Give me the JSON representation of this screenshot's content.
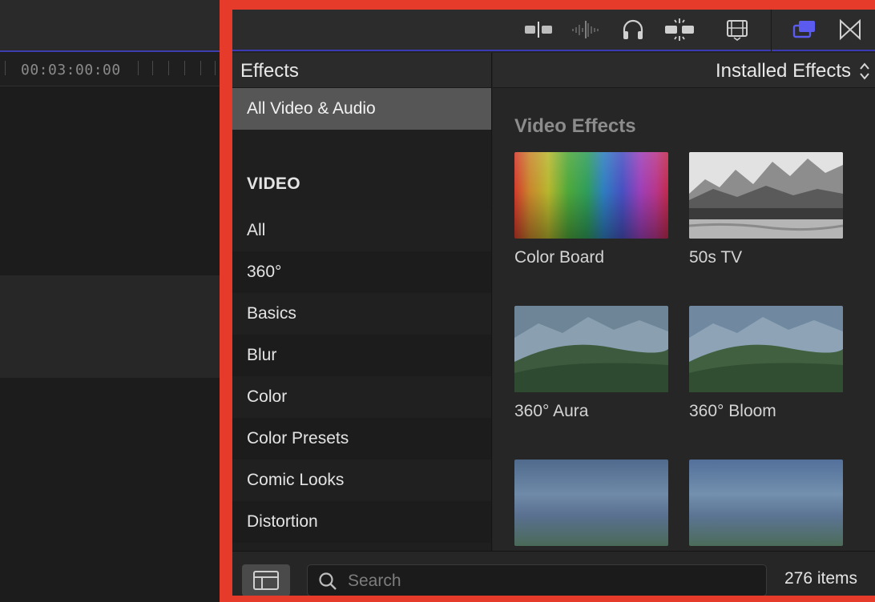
{
  "timeline": {
    "timecode": "00:03:00:00"
  },
  "toolbar": {
    "icons": [
      "clip-skimming-icon",
      "audio-skimming-icon",
      "headphones-icon",
      "snapping-icon",
      "filmstrip-icon",
      "effects-browser-icon",
      "transitions-browser-icon"
    ],
    "accent_color": "#5b5bf0"
  },
  "browser": {
    "title": "Effects",
    "filter_value": "Installed Effects"
  },
  "sidebar": {
    "top_item": "All Video & Audio",
    "section_label": "VIDEO",
    "items": [
      "All",
      "360°",
      "Basics",
      "Blur",
      "Color",
      "Color Presets",
      "Comic Looks",
      "Distortion"
    ]
  },
  "content": {
    "section_title": "Video Effects",
    "effects": [
      {
        "name": "Color Board"
      },
      {
        "name": "50s TV"
      },
      {
        "name": "360° Aura"
      },
      {
        "name": "360° Bloom"
      },
      {
        "name": ""
      },
      {
        "name": ""
      }
    ]
  },
  "footer": {
    "search_placeholder": "Search",
    "item_count": "276 items"
  },
  "colors": {
    "highlight_frame": "#e63a2a",
    "panel_bg": "#232323",
    "selected_row": "#565656"
  }
}
